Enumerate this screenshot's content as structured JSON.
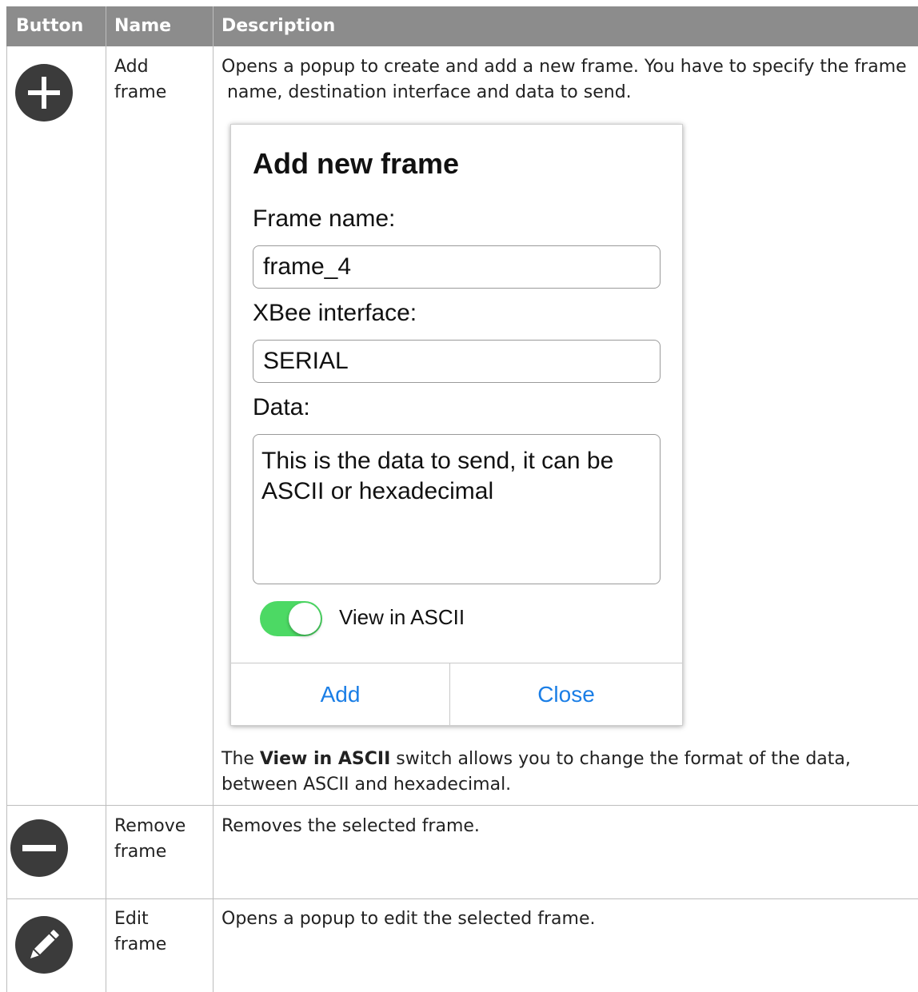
{
  "header": {
    "col_button": "Button",
    "col_name": "Name",
    "col_description": "Description"
  },
  "rows": [
    {
      "icon": "plus-circle-icon",
      "name_line1": "Add",
      "name_line2": "frame",
      "desc_line1": "Opens a popup to create and add a new frame. You have to specify the frame",
      "desc_line2": " name, destination interface and data to send.",
      "note_prefix": "The ",
      "note_bold": "View in ASCII",
      "note_rest": " switch allows you to change the format of the data,",
      "note_line2": "between ASCII and hexadecimal."
    },
    {
      "icon": "minus-circle-icon",
      "name_line1": "Remove",
      "name_line2": "frame",
      "desc_line1": "Removes the selected frame."
    },
    {
      "icon": "pencil-circle-icon",
      "name_line1": "Edit",
      "name_line2": "frame",
      "desc_line1": "Opens a popup to edit the selected frame."
    }
  ],
  "dialog": {
    "title": "Add new frame",
    "frame_name_label": "Frame name:",
    "frame_name_value": "frame_4",
    "interface_label": "XBee interface:",
    "interface_value": "SERIAL",
    "data_label": "Data:",
    "data_line1": "This is the data to send, it can be",
    "data_line2": "ASCII or hexadecimal",
    "toggle_label": "View in ASCII",
    "add_button": "Add",
    "close_button": "Close"
  },
  "colors": {
    "header_bg": "#8c8c8c",
    "icon_bg": "#3b3b3b",
    "toggle_on": "#4cd964",
    "dialog_button": "#1a7ee6"
  }
}
